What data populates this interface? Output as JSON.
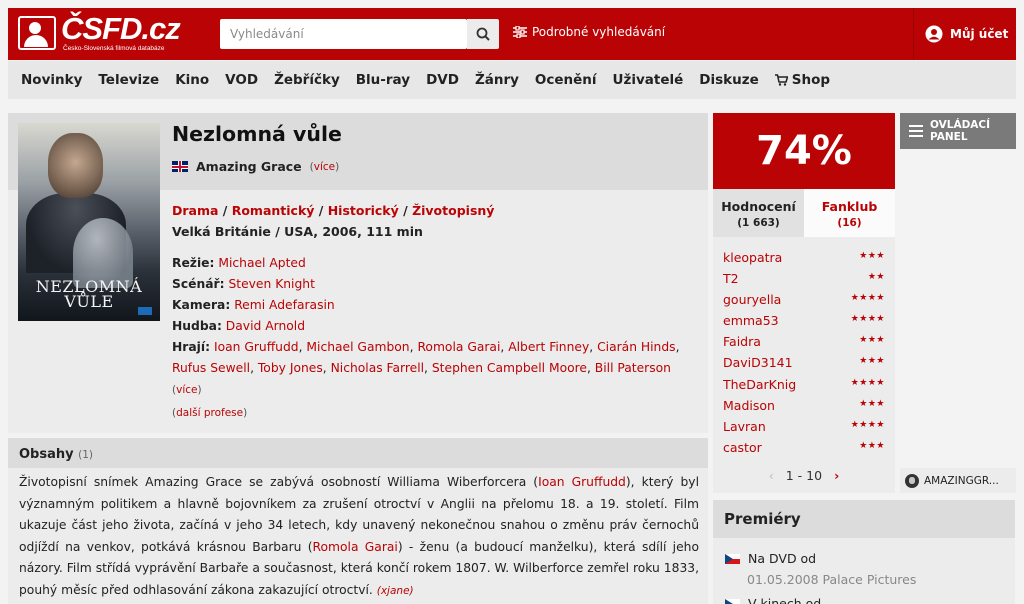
{
  "header": {
    "logo_text": "ČSFD.cz",
    "logo_subtitle": "Česko-Slovenská filmová databáze",
    "search_placeholder": "Vyhledávání",
    "advanced_search": "Podrobné vyhledávání",
    "account": "Můj účet"
  },
  "nav": {
    "items": [
      "Novinky",
      "Televize",
      "Kino",
      "VOD",
      "Žebříčky",
      "Blu-ray",
      "DVD",
      "Žánry",
      "Ocenění",
      "Uživatelé",
      "Diskuze"
    ],
    "shop": "Shop"
  },
  "film": {
    "title": "Nezlomná vůle",
    "original_title": "Amazing Grace",
    "original_more": "více",
    "genres": [
      "Drama",
      "Romantický",
      "Historický",
      "Životopisný"
    ],
    "origin": "Velká Británie / USA, 2006, 111 min",
    "poster": {
      "title_line1": "NEZLOMNÁ",
      "title_line2": "VŮLE"
    },
    "crew": {
      "director_label": "Režie:",
      "director": "Michael Apted",
      "writer_label": "Scénář:",
      "writer": "Steven Knight",
      "camera_label": "Kamera:",
      "camera": "Remi Adefarasin",
      "music_label": "Hudba:",
      "music": "David Arnold",
      "cast_label": "Hrají:",
      "cast": [
        "Ioan Gruffudd",
        "Michael Gambon",
        "Romola Garai",
        "Albert Finney",
        "Ciarán Hinds",
        "Rufus Sewell",
        "Toby Jones",
        "Nicholas Farrell",
        "Stephen Campbell Moore",
        "Bill Paterson"
      ],
      "cast_more": "více",
      "more_professions": "další profese"
    }
  },
  "plot": {
    "heading": "Obsahy",
    "count": "(1)",
    "text_1": "Životopisní snímek Amazing Grace se zabývá osobností Williama Wiberforcera (",
    "text_link_1": "Ioan Gruffudd",
    "text_2": "), který byl významným politikem a hlavně bojovníkem za zrušení otroctví v Anglii na přelomu 18. a 19. století. Film ukazuje část jeho života, začíná v jeho 34 letech, kdy unavený nekonečnou snahou o změnu práv černochů odjíždí na venkov, potkává krásnou Barbaru (",
    "text_link_2": "Romola Garai",
    "text_3": ") - ženu (a budoucí manželku), která sdílí jeho názory. Film střídá vyprávění Barbaře a současnost, která končí rokem 1807. W. Wilberforce zemřel roku 1833, pouhý měsíc před odhlasování zákona zakazující otroctví.",
    "author": "(xjane)"
  },
  "rating": {
    "score": "74%",
    "tab_rating": "Hodnocení",
    "tab_rating_count": "(1 663)",
    "tab_fanclub": "Fanklub",
    "tab_fanclub_count": "(16)",
    "users": [
      {
        "name": "kleopatra",
        "stars": "★★★"
      },
      {
        "name": "T2",
        "stars": "★★"
      },
      {
        "name": "gouryella",
        "stars": "★★★★"
      },
      {
        "name": "emma53",
        "stars": "★★★★"
      },
      {
        "name": "Faidra",
        "stars": "★★★"
      },
      {
        "name": "DaviD3141",
        "stars": "★★★"
      },
      {
        "name": "TheDarKnig",
        "stars": "★★★★"
      },
      {
        "name": "Madison",
        "stars": "★★★"
      },
      {
        "name": "Lavran",
        "stars": "★★★★"
      },
      {
        "name": "castor",
        "stars": "★★★"
      }
    ],
    "pager": "1 - 10"
  },
  "premieres": {
    "heading": "Premiéry",
    "dvd_label": "Na DVD od",
    "dvd_detail": "01.05.2008 Palace Pictures",
    "cinema_label": "V kinech od"
  },
  "side": {
    "panel_label_1": "OVLÁDACÍ",
    "panel_label_2": "PANEL",
    "external_link": "AMAZINGGR..."
  },
  "colors": {
    "brand": "#ba0305",
    "panel": "#7a7a7a"
  }
}
